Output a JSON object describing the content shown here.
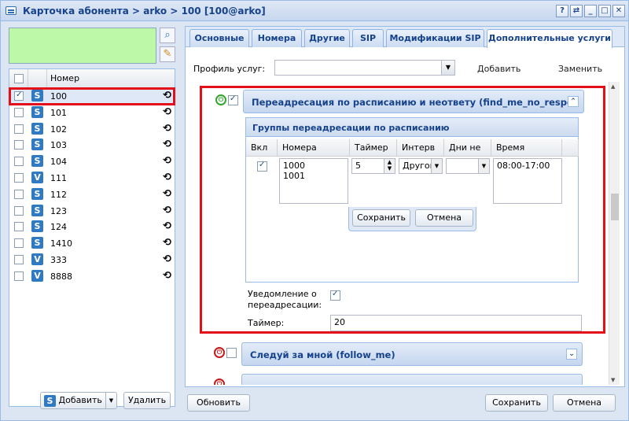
{
  "window": {
    "title": "Карточка абонента > arko > 100 [100@arko]",
    "buttons": [
      "?",
      "⇄",
      "_",
      "□",
      "✕"
    ]
  },
  "left": {
    "column_header": "Номер",
    "rows": [
      {
        "type": "S",
        "number": "100",
        "checked": true,
        "selected": true
      },
      {
        "type": "S",
        "number": "101"
      },
      {
        "type": "S",
        "number": "102"
      },
      {
        "type": "S",
        "number": "103"
      },
      {
        "type": "S",
        "number": "104"
      },
      {
        "type": "V",
        "number": "111"
      },
      {
        "type": "S",
        "number": "112"
      },
      {
        "type": "S",
        "number": "123"
      },
      {
        "type": "S",
        "number": "124"
      },
      {
        "type": "S",
        "number": "1410"
      },
      {
        "type": "V",
        "number": "333"
      },
      {
        "type": "V",
        "number": "8888"
      }
    ],
    "add_label": "Добавить",
    "delete_label": "Удалить"
  },
  "tabs": [
    "Основные",
    "Номера",
    "Другие",
    "SIP",
    "Модификации SIP",
    "Дополнительные услуги"
  ],
  "profile": {
    "label": "Профиль услуг:",
    "value": "",
    "add_label": "Добавить",
    "replace_label": "Заменить"
  },
  "service1": {
    "title": "Переадресация по расписанию и неответу (find_me_no_respo",
    "groups_title": "Группы переадресации по расписанию",
    "columns": [
      "Вкл",
      "Номера",
      "Таймер",
      "Интерв",
      "Дни не",
      "Время"
    ],
    "row": {
      "numbers": "1000\n1001",
      "timer": "5",
      "interval": "Другой",
      "days": "",
      "time": "08:00-17:00"
    },
    "save_label": "Сохранить",
    "cancel_label": "Отмена",
    "notify_label": "Уведомление о переадресации:",
    "timer_label": "Таймер:",
    "timer_value": "20"
  },
  "service2": {
    "title": "Следуй за мной (follow_me)"
  },
  "footer": {
    "refresh": "Обновить",
    "save": "Сохранить",
    "cancel": "Отмена"
  }
}
